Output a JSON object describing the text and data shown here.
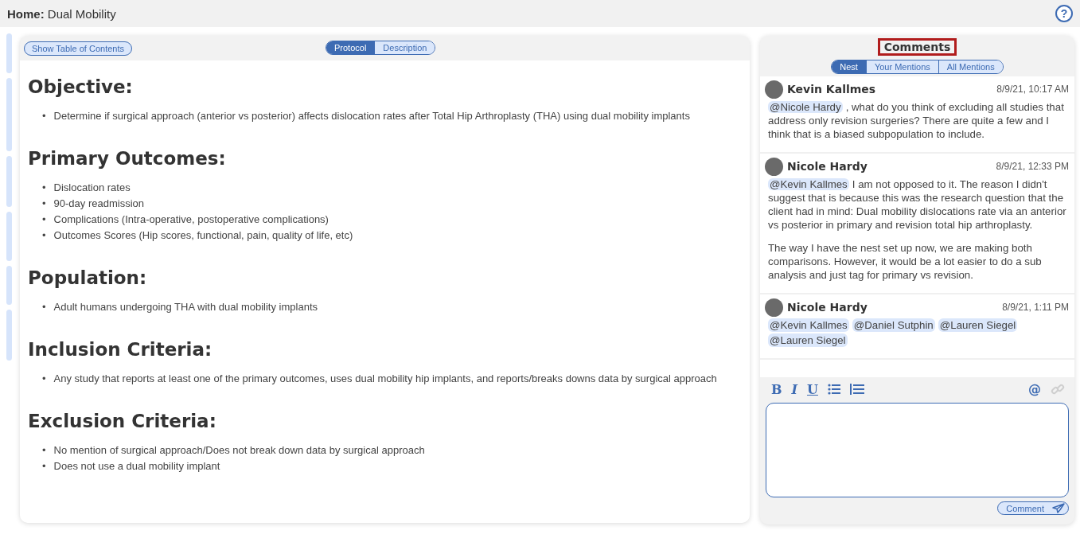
{
  "header": {
    "label": "Home:",
    "title": "Dual Mobility",
    "help": "?"
  },
  "toolbar": {
    "toc_button": "Show Table of Contents",
    "tabs": [
      {
        "label": "Protocol",
        "selected": true
      },
      {
        "label": "Description",
        "selected": false
      }
    ]
  },
  "sections": [
    {
      "heading": "Objective:",
      "items": [
        {
          "marker": "•",
          "text": "Determine if surgical approach (anterior vs posterior) affects dislocation rates after Total Hip Arthroplasty (THA) using dual mobility implants"
        }
      ]
    },
    {
      "heading": "Primary Outcomes:",
      "items": [
        {
          "marker": "•",
          "text": "Dislocation rates"
        },
        {
          "marker": "•",
          "text": "90-day readmission"
        },
        {
          "marker": "•",
          "text": "Complications (Intra-operative, postoperative complications)"
        },
        {
          "marker": "•",
          "text": "Outcomes Scores (Hip scores, functional, pain, quality of life, etc)"
        }
      ]
    },
    {
      "heading": "Population:",
      "items": [
        {
          "marker": "•",
          "text": "Adult humans undergoing THA with dual mobility implants"
        }
      ]
    },
    {
      "heading": "Inclusion Criteria:",
      "items": [
        {
          "marker": "•",
          "text": "Any study that reports at least one of the primary outcomes, uses dual mobility hip implants, and reports/breaks downs data by surgical approach"
        }
      ]
    },
    {
      "heading": "Exclusion Criteria:",
      "items": [
        {
          "marker": "•",
          "text": "No mention of surgical approach/Does not break down data by surgical approach"
        },
        {
          "marker": "•",
          "text": "Does not use a dual mobility implant"
        }
      ]
    }
  ],
  "comments_panel": {
    "title": "Comments",
    "tabs": [
      {
        "label": "Nest",
        "selected": true
      },
      {
        "label": "Your Mentions",
        "selected": false
      },
      {
        "label": "All Mentions",
        "selected": false
      }
    ],
    "comments": [
      {
        "author": "Kevin Kallmes",
        "time": "8/9/21, 10:17 AM",
        "paragraphs": [
          [
            {
              "kind": "mention",
              "text": "@Nicole Hardy"
            },
            {
              "kind": "text",
              "text": ", what do you think of excluding all studies that address only revision surgeries? There are quite a few and I think that is a biased subpopulation to include."
            }
          ]
        ]
      },
      {
        "author": "Nicole Hardy",
        "time": "8/9/21, 12:33 PM",
        "paragraphs": [
          [
            {
              "kind": "mention",
              "text": "@Kevin Kallmes"
            },
            {
              "kind": "text",
              "text": "I am not opposed to it. The reason I didn't suggest that is because this was the research question that the client had in mind: Dual mobility dislocations rate via an anterior vs posterior in primary and revision total hip arthroplasty."
            }
          ],
          [
            {
              "kind": "text",
              "text": "The way I have the nest set up now, we are making both comparisons. However, it would be a lot easier to do a sub analysis and just tag for primary vs revision."
            }
          ]
        ]
      },
      {
        "author": "Nicole Hardy",
        "time": "8/9/21, 1:11 PM",
        "paragraphs": [
          [
            {
              "kind": "mention",
              "text": "@Kevin Kallmes"
            },
            {
              "kind": "mention",
              "text": "@Daniel Sutphin"
            },
            {
              "kind": "mention",
              "text": "@Lauren Siegel"
            },
            {
              "kind": "mention",
              "text": "@Lauren Siegel"
            }
          ]
        ]
      }
    ],
    "editor": {
      "tools": [
        "B",
        "I",
        "U"
      ],
      "mention": "@",
      "submit": "Comment"
    }
  }
}
